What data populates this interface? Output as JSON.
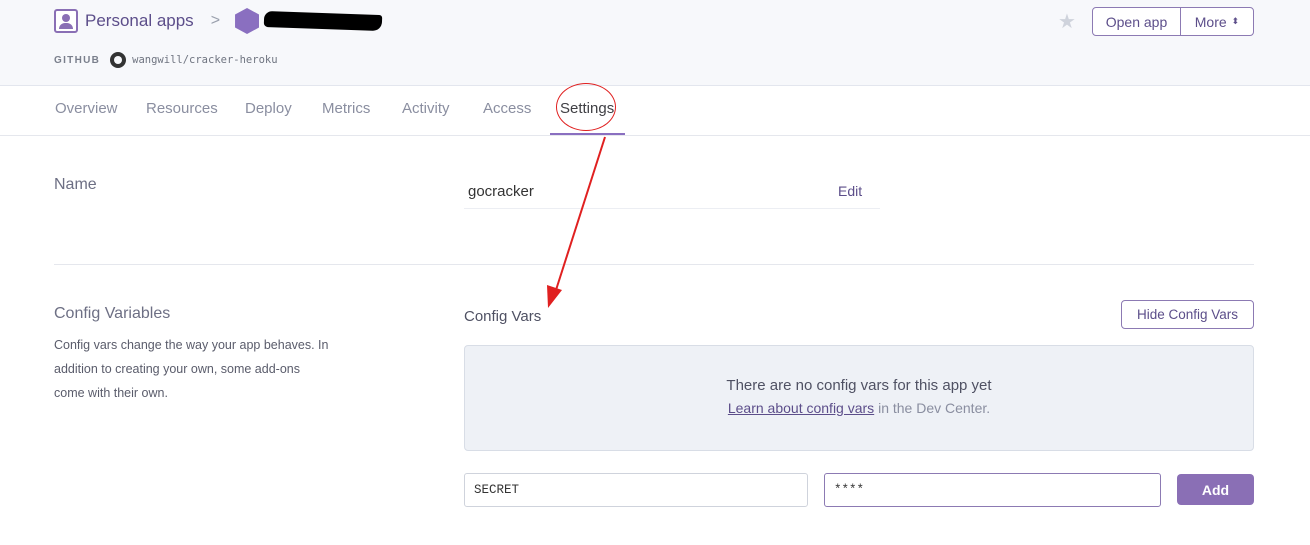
{
  "header": {
    "breadcrumb": {
      "root_label": "Personal apps",
      "separator": ">"
    },
    "github_label": "GITHUB",
    "repo": "wangwill/cracker-heroku",
    "open_app_label": "Open app",
    "more_label": "More"
  },
  "tabs": [
    {
      "label": "Overview"
    },
    {
      "label": "Resources"
    },
    {
      "label": "Deploy"
    },
    {
      "label": "Metrics"
    },
    {
      "label": "Activity"
    },
    {
      "label": "Access"
    },
    {
      "label": "Settings",
      "active": true
    }
  ],
  "name_section": {
    "title": "Name",
    "value": "gocracker",
    "edit_label": "Edit"
  },
  "config_section": {
    "title": "Config Variables",
    "description": "Config vars change the way your app behaves. In addition to creating your own, some add-ons come with their own.",
    "vars_label": "Config Vars",
    "hide_button_label": "Hide Config Vars",
    "empty_message": "There are no config vars for this app yet",
    "learn_link": "Learn about config vars",
    "learn_suffix": " in the Dev Center.",
    "key_value": "SECRET",
    "value_value": "****",
    "add_label": "Add"
  },
  "colors": {
    "accent": "#8a6fb5",
    "annotation": "#e02020"
  }
}
